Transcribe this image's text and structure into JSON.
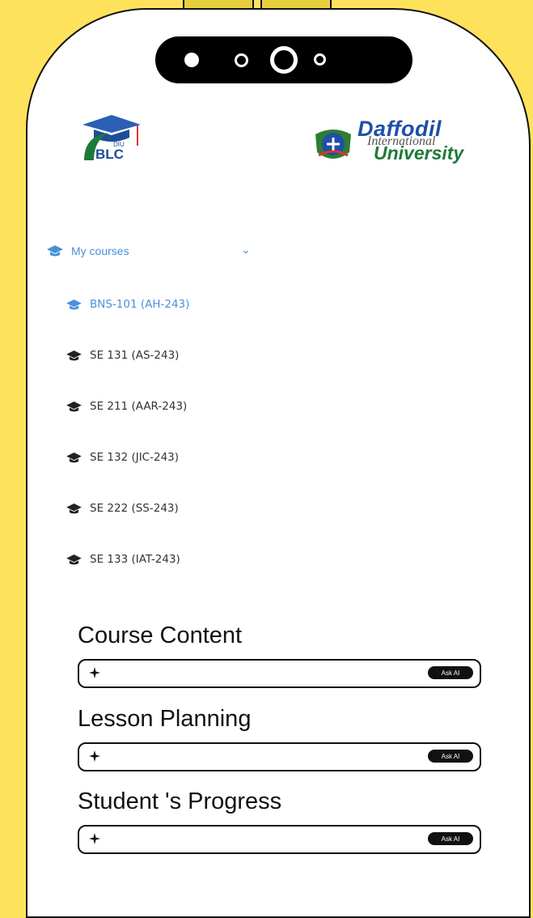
{
  "logos": {
    "blc": {
      "top": "DIU",
      "bottom": "BLC"
    },
    "daffodil": {
      "line1": "Daffodil",
      "line2": "International",
      "line3": "University"
    }
  },
  "menu": {
    "heading": "My courses",
    "courses": [
      {
        "label": "BNS-101 (AH-243)",
        "active": true
      },
      {
        "label": "SE 131 (AS-243)",
        "active": false
      },
      {
        "label": "SE 211 (AAR-243)",
        "active": false
      },
      {
        "label": "SE 132 (JIC-243)",
        "active": false
      },
      {
        "label": "SE 222 (SS-243)",
        "active": false
      },
      {
        "label": "SE 133 (IAT-243)",
        "active": false
      }
    ]
  },
  "sections": [
    {
      "title": "Course Content",
      "button": "Ask AI"
    },
    {
      "title": "Lesson Planning",
      "button": "Ask AI"
    },
    {
      "title": "Student 's Progress",
      "button": "Ask AI"
    }
  ],
  "colors": {
    "background": "#FFE25C",
    "accent": "#4A90D9",
    "daffodil_blue": "#1E4FA8",
    "daffodil_green": "#1E7A3A"
  },
  "icons": {
    "course": "graduation-cap-icon",
    "sparkle": "sparkle-icon",
    "chevron": "chevron-down-icon"
  }
}
